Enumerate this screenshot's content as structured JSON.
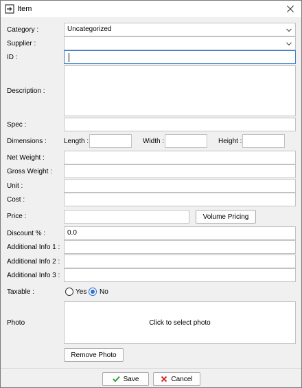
{
  "window": {
    "title": "Item",
    "app_icon": "item-window-icon",
    "close_icon": "close-icon"
  },
  "labels": {
    "category": "Category :",
    "supplier": "Supplier :",
    "id": "ID :",
    "description": "Description :",
    "spec": "Spec :",
    "dimensions": "Dimensions :",
    "length": "Length :",
    "width": "Width :",
    "height": "Height :",
    "net_weight": "Net Weight :",
    "gross_weight": "Gross Weight :",
    "unit": "Unit :",
    "cost": "Cost :",
    "price": "Price :",
    "discount": "Discount % :",
    "additional_info_1": "Additional Info 1 :",
    "additional_info_2": "Additional Info 2 :",
    "additional_info_3": "Additional Info 3 :",
    "taxable": "Taxable :",
    "photo": "Photo"
  },
  "values": {
    "category": "Uncategorized",
    "supplier": "",
    "id": "",
    "description": "",
    "spec": "",
    "length": "",
    "width": "",
    "height": "",
    "net_weight": "",
    "gross_weight": "",
    "unit": "",
    "cost": "",
    "price": "",
    "discount": "0.0",
    "additional_info_1": "",
    "additional_info_2": "",
    "additional_info_3": ""
  },
  "taxable": {
    "yes_label": "Yes",
    "no_label": "No",
    "selected": "No"
  },
  "buttons": {
    "volume_pricing": "Volume Pricing",
    "photo_placeholder": "Click to select photo",
    "remove_photo": "Remove Photo",
    "save": "Save",
    "cancel": "Cancel"
  },
  "colors": {
    "save_check": "#2e9e3a",
    "cancel_x": "#d62828",
    "radio_selected": "#2f6fd1",
    "focus_border": "#3c7fd1"
  }
}
